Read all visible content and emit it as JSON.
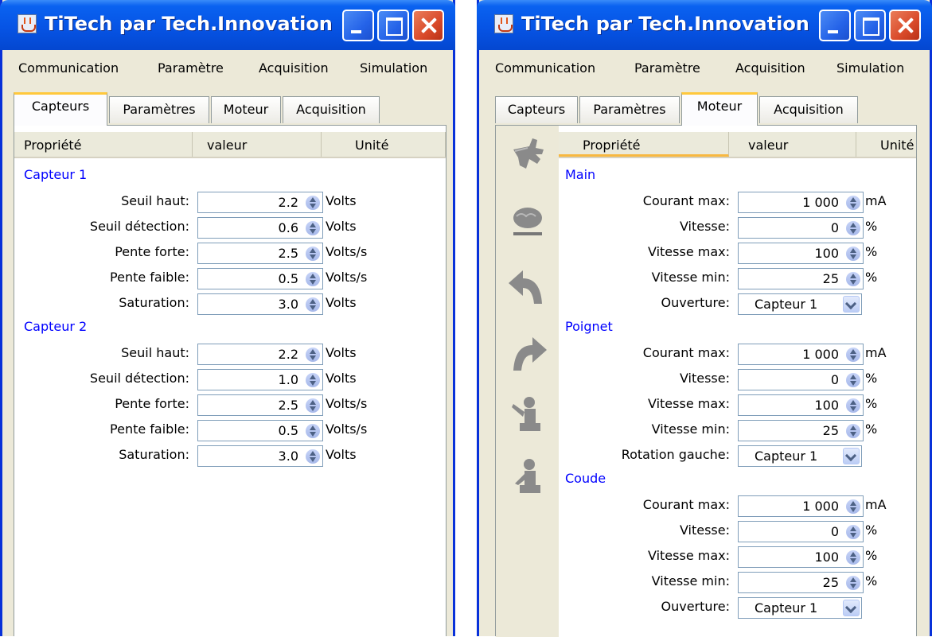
{
  "windows": [
    {
      "title": "TiTech par Tech.Innovation",
      "menu": [
        "Communication",
        "Paramètre",
        "Acquisition",
        "Simulation"
      ],
      "tabs": [
        "Capteurs",
        "Paramètres",
        "Moteur",
        "Acquisition"
      ],
      "selected_tab": "Capteurs",
      "columns": [
        "Propriété",
        "valeur",
        "Unité"
      ],
      "sections": [
        {
          "name": "Capteur 1",
          "rows": [
            {
              "label": "Seuil haut:",
              "value": "2.2",
              "unit": "Volts"
            },
            {
              "label": "Seuil détection:",
              "value": "0.6",
              "unit": "Volts"
            },
            {
              "label": "Pente forte:",
              "value": "2.5",
              "unit": "Volts/s"
            },
            {
              "label": "Pente faible:",
              "value": "0.5",
              "unit": "Volts/s"
            },
            {
              "label": "Saturation:",
              "value": "3.0",
              "unit": "Volts"
            }
          ]
        },
        {
          "name": "Capteur 2",
          "rows": [
            {
              "label": "Seuil haut:",
              "value": "2.2",
              "unit": "Volts"
            },
            {
              "label": "Seuil détection:",
              "value": "1.0",
              "unit": "Volts"
            },
            {
              "label": "Pente forte:",
              "value": "2.5",
              "unit": "Volts/s"
            },
            {
              "label": "Pente faible:",
              "value": "0.5",
              "unit": "Volts/s"
            },
            {
              "label": "Saturation:",
              "value": "3.0",
              "unit": "Volts"
            }
          ]
        }
      ]
    },
    {
      "title": "TiTech par Tech.Innovation",
      "menu": [
        "Communication",
        "Paramètre",
        "Acquisition",
        "Simulation"
      ],
      "tabs": [
        "Capteurs",
        "Paramètres",
        "Moteur",
        "Acquisition"
      ],
      "selected_tab": "Moteur",
      "columns": [
        "Propriété",
        "valeur",
        "Unité"
      ],
      "sidebar_icons": [
        "hand-open-icon",
        "hand-closed-icon",
        "rotate-left-arrow-icon",
        "rotate-right-arrow-icon",
        "arm-raised-figure-icon",
        "arm-lowered-figure-icon"
      ],
      "sections": [
        {
          "name": "Main",
          "rows": [
            {
              "label": "Courant max:",
              "value": "1 000",
              "unit": "mA",
              "type": "spinner"
            },
            {
              "label": "Vitesse:",
              "value": "0",
              "unit": "%",
              "type": "spinner"
            },
            {
              "label": "Vitesse max:",
              "value": "100",
              "unit": "%",
              "type": "spinner"
            },
            {
              "label": "Vitesse min:",
              "value": "25",
              "unit": "%",
              "type": "spinner"
            },
            {
              "label": "Ouverture:",
              "value": "Capteur 1",
              "unit": "",
              "type": "combo"
            }
          ]
        },
        {
          "name": "Poignet",
          "rows": [
            {
              "label": "Courant max:",
              "value": "1 000",
              "unit": "mA",
              "type": "spinner"
            },
            {
              "label": "Vitesse:",
              "value": "0",
              "unit": "%",
              "type": "spinner"
            },
            {
              "label": "Vitesse max:",
              "value": "100",
              "unit": "%",
              "type": "spinner"
            },
            {
              "label": "Vitesse min:",
              "value": "25",
              "unit": "%",
              "type": "spinner"
            },
            {
              "label": "Rotation gauche:",
              "value": "Capteur 1",
              "unit": "",
              "type": "combo"
            }
          ]
        },
        {
          "name": "Coude",
          "rows": [
            {
              "label": "Courant max:",
              "value": "1 000",
              "unit": "mA",
              "type": "spinner"
            },
            {
              "label": "Vitesse:",
              "value": "0",
              "unit": "%",
              "type": "spinner"
            },
            {
              "label": "Vitesse max:",
              "value": "100",
              "unit": "%",
              "type": "spinner"
            },
            {
              "label": "Vitesse min:",
              "value": "25",
              "unit": "%",
              "type": "spinner"
            },
            {
              "label": "Ouverture:",
              "value": "Capteur 1",
              "unit": "",
              "type": "combo"
            }
          ]
        }
      ]
    }
  ],
  "colors": {
    "titlebar": "#0a62f0",
    "window_bg": "#ece9d8",
    "section_text": "#0000ff",
    "tab_highlight": "#ffc83c",
    "close_button": "#d94a2a"
  }
}
